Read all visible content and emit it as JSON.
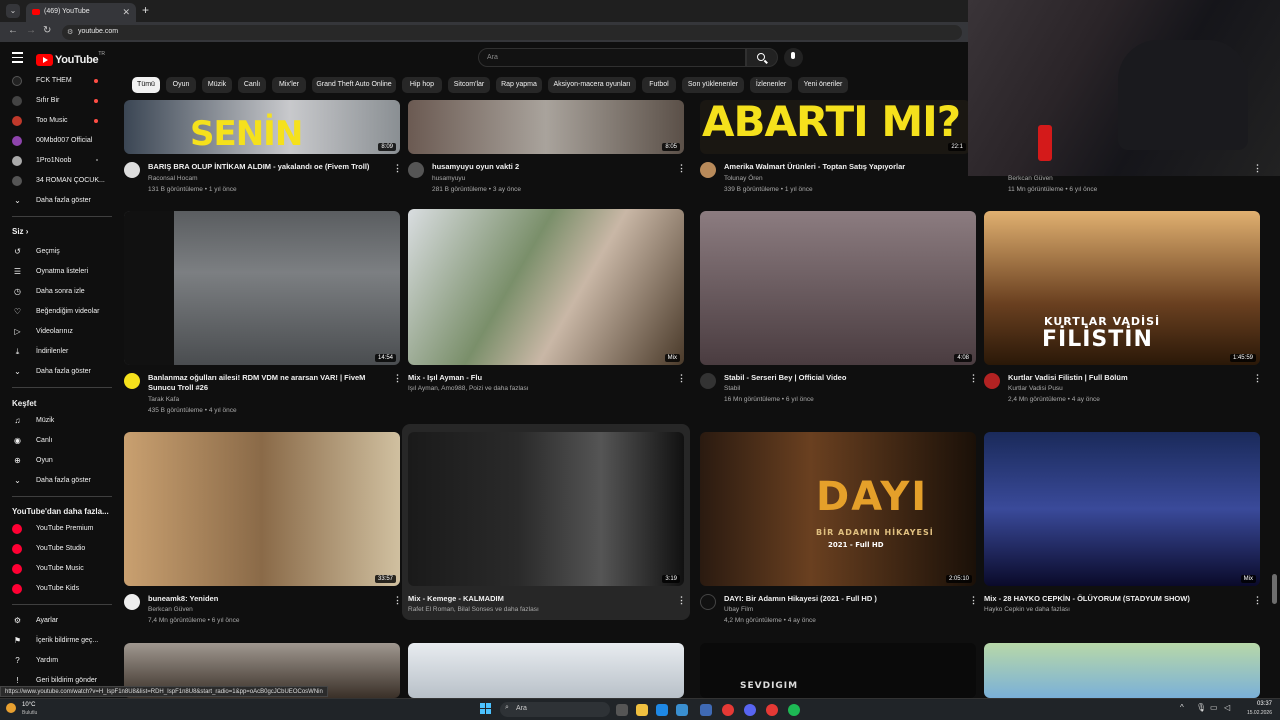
{
  "browser": {
    "tab_title": "(469) YouTube",
    "url": "youtube.com",
    "status_url": "https://www.youtube.com/watch?v=H_IspF1n8U8&list=RDH_IspF1n8U8&start_radio=1&pp=oAcB0gcJCbUEOCosWNin"
  },
  "header": {
    "logo_text": "YouTube",
    "logo_country": "TR",
    "search_placeholder": "Ara"
  },
  "chips": [
    "Tümü",
    "Oyun",
    "Müzik",
    "Canlı",
    "Mix'ler",
    "Grand Theft Auto Online",
    "Hip hop",
    "Sitcom'lar",
    "Rap yapma",
    "Aksiyon-macera oyunları",
    "Futbol",
    "Son yüklenenler",
    "İzlenenler",
    "Yeni öneriler"
  ],
  "sidebar": {
    "subscriptions": [
      {
        "label": "FCK THEM",
        "color": "#222"
      },
      {
        "label": "Sıfır Bir",
        "color": "#444"
      },
      {
        "label": "Too Music",
        "color": "#c0392b"
      },
      {
        "label": "00Mbd007 Official",
        "color": "#8e44ad"
      },
      {
        "label": "1Pro1Noob",
        "color": "#aaa"
      },
      {
        "label": "34 ROMAN ÇOCUK...",
        "color": "#555"
      }
    ],
    "show_more": "Daha fazla göster",
    "you_header": "Siz",
    "you_items": [
      "Geçmiş",
      "Oynatma listeleri",
      "Daha sonra izle",
      "Beğendiğim videolar",
      "Videolarınız",
      "İndirilenler",
      "Daha fazla göster"
    ],
    "explore_header": "Keşfet",
    "explore_items": [
      "Müzik",
      "Canlı",
      "Oyun",
      "Daha fazla göster"
    ],
    "more_header": "YouTube'dan daha fazla...",
    "more_items": [
      "YouTube Premium",
      "YouTube Studio",
      "YouTube Music",
      "YouTube Kids"
    ],
    "settings_items": [
      "Ayarlar",
      "İçerik bildirme geç...",
      "Yardım",
      "Geri bildirim gönder"
    ]
  },
  "videos_row1": [
    {
      "title": "BARIŞ BRA OLUP İNTİKAM ALDIM - yakalandı oe (Fivem Troll)",
      "channel": "Raconsal Hocam",
      "meta": "131 B görüntüleme • 1 yıl önce",
      "duration": "8:09",
      "overlay": "SENİN ANANI"
    },
    {
      "title": "husamyuyu oyun vakti 2",
      "channel": "husamyuyu",
      "meta": "281 B görüntüleme • 3 ay önce",
      "duration": "8:05"
    },
    {
      "title": "Amerika Walmart Ürünleri - Toptan Satış Yapıyorlar",
      "channel": "Tolunay Ören",
      "meta": "339 B görüntüleme • 1 yıl önce",
      "duration": "22:1",
      "overlay": "ABARTI MI?"
    },
    {
      "title": "",
      "channel": "Berkcan Güven",
      "meta": "11 Mn görüntüleme • 6 yıl önce",
      "duration": ""
    }
  ],
  "videos_row2": [
    {
      "title": "Banlanmaz oğulları ailesi! RDM VDM ne ararsan VAR! | FiveM Sunucu Troll #26",
      "channel": "Tarak Kafa",
      "meta": "435 B görüntüleme • 4 yıl önce",
      "duration": "14:54"
    },
    {
      "title": "Mix - Işıl Ayman - Flu",
      "channel": "Işıl Ayman, Amo988, Poizi ve daha fazlası",
      "meta": "",
      "duration": "Mix"
    },
    {
      "title": "Stabil - Serseri Bey | Official Video",
      "channel": "Stabil",
      "meta": "16 Mn görüntüleme • 6 yıl önce",
      "duration": "4:08"
    },
    {
      "title": "Kurtlar Vadisi Filistin | Full Bölüm",
      "channel": "Kurtlar Vadisi Pusu",
      "meta": "2,4 Mn görüntüleme • 4 ay önce",
      "duration": "1:45:59",
      "overlay1": "KURTLAR VADİSİ",
      "overlay2": "FİLİSTİN"
    }
  ],
  "videos_row3": [
    {
      "title": "buneamk8: Yeniden",
      "channel": "Berkcan Güven",
      "meta": "7,4 Mn görüntüleme • 6 yıl önce",
      "duration": "33:57"
    },
    {
      "title": "Mix - Kemege - KALMADIM",
      "channel": "Rafet El Roman, Bilal Sonses ve daha fazlası",
      "meta": "",
      "duration": "3:19"
    },
    {
      "title": "DAYI: Bir Adamın Hikayesi (2021 - Full HD )",
      "channel": "Ubay Film",
      "meta": "4,2 Mn görüntüleme • 4 ay önce",
      "duration": "2:05:10",
      "overlay1": "DAYI",
      "overlay2": "BİR ADAMIN HİKAYESİ",
      "overlay3": "2021 - Full HD"
    },
    {
      "title": "Mix - 28 HAYKO CEPKİN - ÖLÜYORUM (STADYUM SHOW)",
      "channel": "Hayko Cepkin ve daha fazlası",
      "meta": "",
      "duration": "Mix"
    }
  ],
  "row4_overlay": "SEVDIGIM",
  "taskbar": {
    "weather_temp": "10°C",
    "weather_desc": "Bulutlu",
    "search": "Ara",
    "time": "03:37",
    "date": "15.02.2026"
  }
}
